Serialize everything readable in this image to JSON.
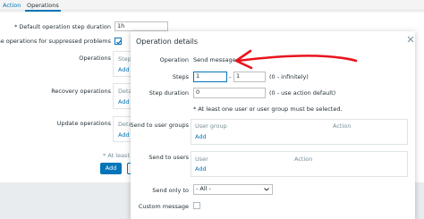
{
  "tabs": [
    {
      "label": "Action"
    },
    {
      "label": "Operations"
    }
  ],
  "background_form": {
    "default_step_duration_label": "* Default operation step duration",
    "default_step_duration_value": "1h",
    "pause_suppressed_label": "Pause operations for suppressed problems",
    "operations_label": "Operations",
    "operations_steps_fragment": "Steps",
    "operations_add": "Add",
    "recovery_label": "Recovery operations",
    "recovery_details_fragment": "Detai",
    "recovery_add": "Add",
    "update_label": "Update operations",
    "update_details_fragment": "Detai",
    "update_add": "Add",
    "at_least_fragment": "* At least on",
    "add_button": "Add"
  },
  "dialog": {
    "title": "Operation details",
    "operation_label": "Operation",
    "operation_value": "Send message",
    "steps_label": "Steps",
    "steps_from": "1",
    "steps_separator": "-",
    "steps_to": "1",
    "steps_hint": "(0 - infinitely)",
    "step_duration_label": "Step duration",
    "step_duration_value": "0",
    "step_duration_hint": "(0 - use action default)",
    "requirement_note": "* At least one user or user group must be selected.",
    "send_to_groups_label": "Send to user groups",
    "groups_col_user_group": "User group",
    "groups_col_action": "Action",
    "groups_add": "Add",
    "send_to_users_label": "Send to users",
    "users_col_user": "User",
    "users_col_action": "Action",
    "users_add": "Add",
    "send_only_to_label": "Send only to",
    "send_only_to_value": "- All -",
    "custom_message_label": "Custom message"
  },
  "annotation": {
    "color": "#e8141c"
  }
}
